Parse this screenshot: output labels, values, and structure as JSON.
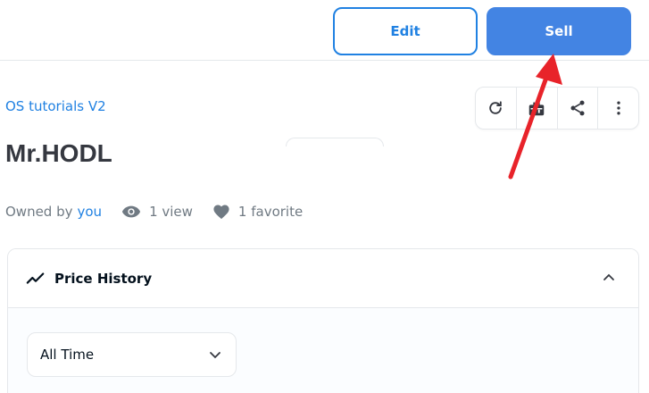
{
  "toolbar": {
    "edit_label": "Edit",
    "sell_label": "Sell"
  },
  "item": {
    "collection": "OS tutorials V2",
    "title": "Mr.HODL",
    "owned_by_prefix": "Owned by",
    "owner": "you",
    "views": "1 view",
    "favorites": "1 favorite"
  },
  "action_icons": [
    "refresh-icon",
    "gift-icon",
    "share-icon",
    "more-icon"
  ],
  "price_history": {
    "label": "Price History",
    "range_selected": "All Time"
  },
  "colors": {
    "accent": "#2081e2",
    "sell_button": "#4384e3",
    "annotation_arrow": "#e8232a"
  }
}
